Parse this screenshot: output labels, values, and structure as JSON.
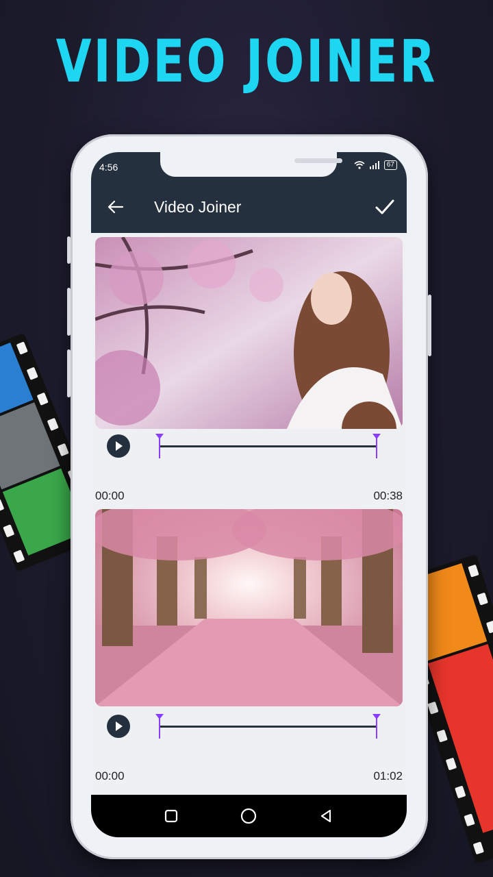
{
  "headline": "VIDEO JOINER",
  "status": {
    "time": "4:56",
    "battery": "67"
  },
  "appbar": {
    "title": "Video Joiner",
    "back_icon": "arrow-left-icon",
    "confirm_icon": "check-icon"
  },
  "clips": [
    {
      "start_time": "00:00",
      "end_time": "00:38",
      "trim_start": 0,
      "trim_end": 1
    },
    {
      "start_time": "00:00",
      "end_time": "01:02",
      "trim_start": 0,
      "trim_end": 1
    }
  ],
  "navbar": {
    "icons": [
      "recents-square-icon",
      "home-circle-icon",
      "back-triangle-icon"
    ]
  },
  "colors": {
    "headline": "#1fd6f2",
    "appbar": "#24303d",
    "trim_handle": "#8a3dff"
  }
}
